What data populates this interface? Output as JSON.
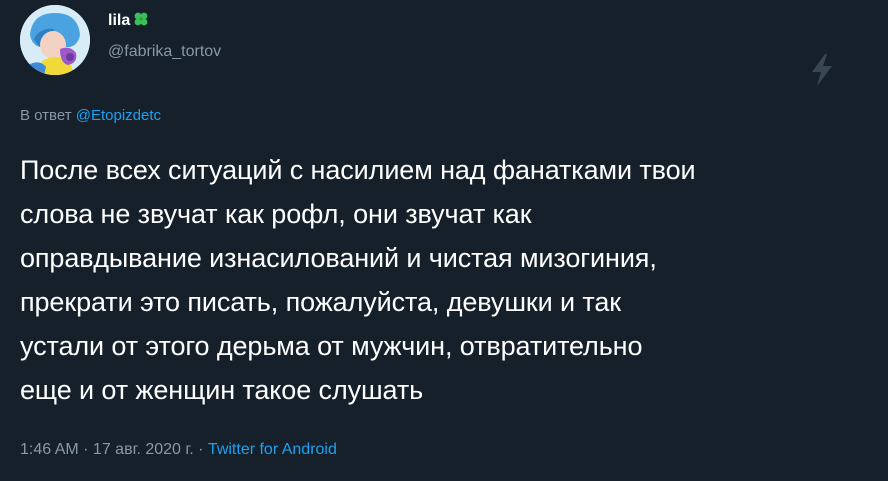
{
  "author": {
    "display_name": "lila",
    "badge_emoji": "✤",
    "username": "@fabrika_tortov",
    "avatar_icon": "avatar-image"
  },
  "reply": {
    "prefix": "В ответ",
    "mention": "@Etopizdetc"
  },
  "tweet": {
    "lines": [
      "После всех ситуаций с насилием над фанатками твои",
      "слова не звучат как рофл, они звучат как",
      "оправдывание изнасилований и чистая мизогиния,",
      "прекрати это писать, пожалуйста, девушки и так",
      "устали от этого дерьма от мужчин, отвратительно",
      "еще и от женщин такое слушать"
    ]
  },
  "meta": {
    "time": "1:46 AM",
    "separator": " · ",
    "date": "17 авг. 2020 г.",
    "source": "Twitter for Android"
  },
  "icons": {
    "top_right": "lightning-bolt-icon"
  },
  "colors": {
    "background": "#15202b",
    "text": "#ffffff",
    "secondary": "#8899a6",
    "accent": "#1da1f2",
    "clover": "#3bbf57"
  }
}
